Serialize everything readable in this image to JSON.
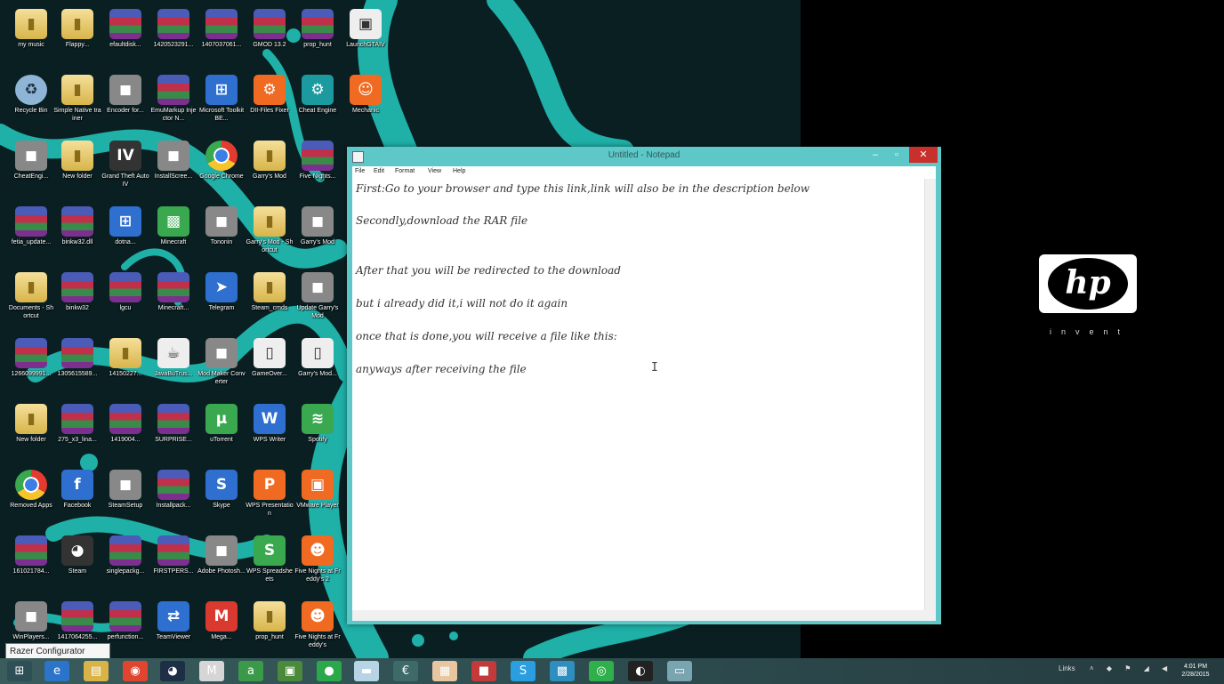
{
  "desktop": {
    "colors": {
      "wallpaper_left": "#0a1f22",
      "swirl": "#1fb0a8",
      "background_right": "#000000"
    },
    "icons": [
      {
        "label": "my music",
        "icon": "folder-icon"
      },
      {
        "label": "Flappy...",
        "icon": "folder-icon"
      },
      {
        "label": "efaultdisk...",
        "icon": "rar-archive-icon"
      },
      {
        "label": "1420523291...",
        "icon": "rar-archive-icon"
      },
      {
        "label": "1407037061...",
        "icon": "rar-archive-icon"
      },
      {
        "label": "GMOD 13.2",
        "icon": "rar-archive-icon"
      },
      {
        "label": "prop_hunt",
        "icon": "rar-archive-icon"
      },
      {
        "label": "LaunchGTAIV",
        "icon": "app-window-icon"
      },
      {
        "label": "Recycle Bin",
        "icon": "recycle-bin-icon"
      },
      {
        "label": "Simple Native trainer",
        "icon": "folder-icon"
      },
      {
        "label": "Encoder for...",
        "icon": "app-icon"
      },
      {
        "label": "EmuMarkup Injector N...",
        "icon": "rar-archive-icon"
      },
      {
        "label": "Microsoft Toolkit BE...",
        "icon": "windows-icon"
      },
      {
        "label": "DII-Files Fixer",
        "icon": "gear-icon"
      },
      {
        "label": "Cheat Engine",
        "icon": "cheat-engine-icon"
      },
      {
        "label": "Mechanic",
        "icon": "character-icon"
      },
      {
        "label": "CheatEngi...",
        "icon": "app-icon"
      },
      {
        "label": "New folder",
        "icon": "folder-icon"
      },
      {
        "label": "Grand Theft Auto IV",
        "icon": "gta-icon"
      },
      {
        "label": "InstallScree...",
        "icon": "app-icon"
      },
      {
        "label": "Google Chrome",
        "icon": "chrome-icon"
      },
      {
        "label": "Garry's Mod",
        "icon": "folder-icon"
      },
      {
        "label": "Five Nights...",
        "icon": "rar-archive-icon"
      },
      {
        "label": "fetia_update...",
        "icon": "rar-archive-icon"
      },
      {
        "label": "binkw32.dll",
        "icon": "rar-archive-icon"
      },
      {
        "label": "dotna...",
        "icon": "windows-icon"
      },
      {
        "label": "Minecraft",
        "icon": "minecraft-icon"
      },
      {
        "label": "Tononin",
        "icon": "app-icon"
      },
      {
        "label": "Garry's Mod - Shortcut",
        "icon": "folder-icon"
      },
      {
        "label": "Garry's Mod",
        "icon": "app-icon"
      },
      {
        "label": "Documents - Shortcut",
        "icon": "folder-icon"
      },
      {
        "label": "binkw32",
        "icon": "rar-archive-icon"
      },
      {
        "label": "lgcu",
        "icon": "rar-archive-icon"
      },
      {
        "label": "Minecraft...",
        "icon": "rar-archive-icon"
      },
      {
        "label": "Telegram",
        "icon": "telegram-icon"
      },
      {
        "label": "Steam_cmds",
        "icon": "folder-icon"
      },
      {
        "label": "Update Garry's Mod",
        "icon": "app-icon"
      },
      {
        "label": "1266099991...",
        "icon": "rar-archive-icon"
      },
      {
        "label": "1305615589...",
        "icon": "rar-archive-icon"
      },
      {
        "label": "14150227...",
        "icon": "folder-icon"
      },
      {
        "label": "JavaBuTrus...",
        "icon": "java-icon"
      },
      {
        "label": "Mod Maker Converter",
        "icon": "app-icon"
      },
      {
        "label": "GameOver...",
        "icon": "document-icon"
      },
      {
        "label": "Garry's Mod...",
        "icon": "document-icon"
      },
      {
        "label": "New folder",
        "icon": "folder-icon"
      },
      {
        "label": "275_x3_lina...",
        "icon": "rar-archive-icon"
      },
      {
        "label": "1419004...",
        "icon": "rar-archive-icon"
      },
      {
        "label": "SURPRISE...",
        "icon": "rar-archive-icon"
      },
      {
        "label": "uTorrent",
        "icon": "utorrent-icon"
      },
      {
        "label": "WPS Writer",
        "icon": "wps-writer-icon"
      },
      {
        "label": "Spotify",
        "icon": "spotify-icon"
      },
      {
        "label": "Removed Apps",
        "icon": "chrome-icon"
      },
      {
        "label": "Facebook",
        "icon": "facebook-icon"
      },
      {
        "label": "SteamSetup",
        "icon": "app-icon"
      },
      {
        "label": "Installpack...",
        "icon": "rar-archive-icon"
      },
      {
        "label": "Skype",
        "icon": "skype-icon"
      },
      {
        "label": "WPS Presentation",
        "icon": "wps-presentation-icon"
      },
      {
        "label": "VMware Player",
        "icon": "vmware-icon"
      },
      {
        "label": "161021784...",
        "icon": "rar-archive-icon"
      },
      {
        "label": "Steam",
        "icon": "steam-icon"
      },
      {
        "label": "singlepackg...",
        "icon": "rar-archive-icon"
      },
      {
        "label": "FIRSTPERS...",
        "icon": "rar-archive-icon"
      },
      {
        "label": "Adobe Photosh...",
        "icon": "app-icon"
      },
      {
        "label": "WPS Spreadsheets",
        "icon": "wps-spreadsheets-icon"
      },
      {
        "label": "Five Nights at Freddy's 2",
        "icon": "fnaf-icon"
      },
      {
        "label": "WinPlayers...",
        "icon": "app-icon"
      },
      {
        "label": "1417064255...",
        "icon": "rar-archive-icon"
      },
      {
        "label": "perfunction...",
        "icon": "rar-archive-icon"
      },
      {
        "label": "TeamViewer",
        "icon": "teamviewer-icon"
      },
      {
        "label": "Mega...",
        "icon": "mega-icon"
      },
      {
        "label": "prop_hunt",
        "icon": "folder-icon"
      },
      {
        "label": "Five Nights at Freddy's",
        "icon": "fnaf-icon"
      }
    ]
  },
  "notepad": {
    "title": "Untitled - Notepad",
    "menu": [
      "File",
      "Edit",
      "Format",
      "View",
      "Help"
    ],
    "window_buttons": {
      "minimize": "–",
      "maximize": "▫",
      "close": "✕"
    },
    "lines": [
      "First:Go to your browser and type this link,link will also be in the description below",
      "Secondly,download the RAR file",
      "After that you will be redirected to the download",
      "but i already did it,i will not do it again",
      "once that is done,you will receive a file like this:",
      "anyways after receiving the file"
    ]
  },
  "hp": {
    "logo": "hp",
    "tagline": "invent"
  },
  "tooltip": {
    "text": "Razer Configurator"
  },
  "taskbar": {
    "pinned": [
      {
        "name": "windows-start-icon",
        "glyph": "⊞",
        "color": "#2d4f55"
      },
      {
        "name": "internet-explorer-icon",
        "glyph": "e",
        "color": "#2b74c9"
      },
      {
        "name": "file-explorer-icon",
        "glyph": "▤",
        "color": "#d9b347"
      },
      {
        "name": "chrome-icon",
        "glyph": "◉",
        "color": "#e0452f"
      },
      {
        "name": "steam-icon",
        "glyph": "◕",
        "color": "#1d2f45"
      },
      {
        "name": "gmail-icon",
        "glyph": "M",
        "color": "#d6d6d6"
      },
      {
        "name": "app-green-icon",
        "glyph": "a",
        "color": "#3b9a4a"
      },
      {
        "name": "app-photo-icon",
        "glyph": "▣",
        "color": "#4a8a3a"
      },
      {
        "name": "app-round-icon",
        "glyph": "●",
        "color": "#2aa84a"
      },
      {
        "name": "notepad-icon",
        "glyph": "▬",
        "color": "#b6d4e6"
      },
      {
        "name": "camtasia-icon",
        "glyph": "€",
        "color": "#3e6a6a"
      },
      {
        "name": "calendar-icon",
        "glyph": "▦",
        "color": "#e8c6a0"
      },
      {
        "name": "app-red-icon",
        "glyph": "■",
        "color": "#c33a3a"
      },
      {
        "name": "skype-icon",
        "glyph": "S",
        "color": "#2b9ee0"
      },
      {
        "name": "photos-icon",
        "glyph": "▩",
        "color": "#2e8ec0"
      },
      {
        "name": "spotify-icon",
        "glyph": "◎",
        "color": "#2fb04a"
      },
      {
        "name": "obs-icon",
        "glyph": "◐",
        "color": "#222222"
      },
      {
        "name": "notepad-active-icon",
        "glyph": "▭",
        "color": "#7aa4b0"
      }
    ],
    "tray_label": "Links",
    "clock": {
      "time": "4:01 PM",
      "date": "2/28/2015"
    }
  }
}
